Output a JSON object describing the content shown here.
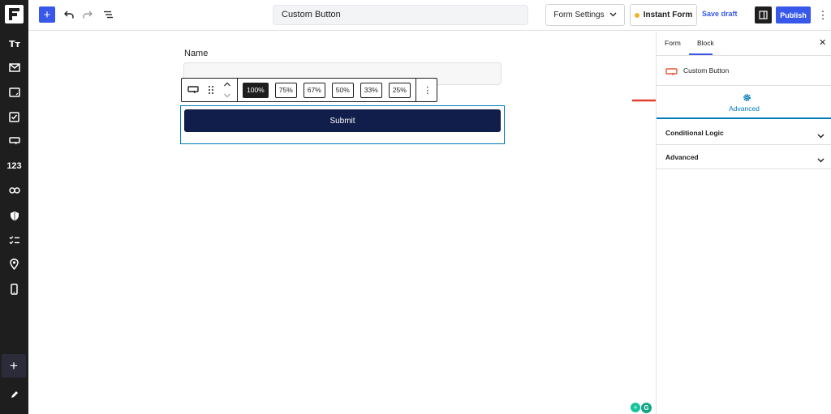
{
  "topbar": {
    "doc_title": "Custom Button",
    "form_settings_label": "Form Settings",
    "instant_form_label": "Instant Form",
    "save_draft_label": "Save draft",
    "publish_label": "Publish"
  },
  "rail": {
    "number_label": "123"
  },
  "canvas": {
    "field_label": "Name",
    "width_options": [
      "100%",
      "75%",
      "67%",
      "50%",
      "33%",
      "25%"
    ],
    "selected_width": "100%",
    "submit_label": "Submit"
  },
  "sidebar": {
    "tabs": [
      "Form",
      "Block"
    ],
    "active_tab": "Block",
    "block_name": "Custom Button",
    "advanced_tab_label": "Advanced",
    "panels": [
      "Conditional Logic",
      "Advanced"
    ]
  },
  "colors": {
    "accent": "#3858e9",
    "rail": "#1e1e1e",
    "submit_button": "#111d4a",
    "highlight": "#007cba",
    "annotation_arrow": "#e53d2f",
    "status_dot": "#f0b429"
  }
}
